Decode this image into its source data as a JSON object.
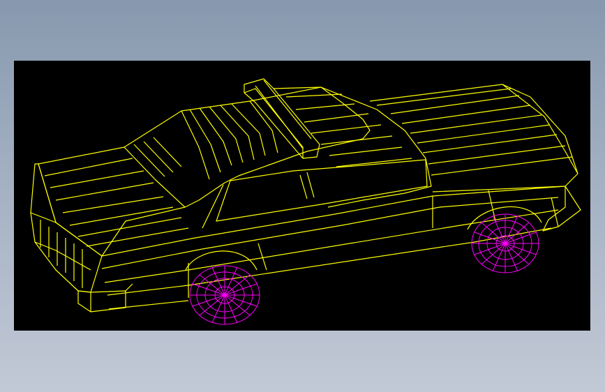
{
  "viewport": {
    "background": "#000000",
    "line_color": "#ffff00",
    "wheel_color": "#ff00ff",
    "model": "police-car-wireframe"
  }
}
